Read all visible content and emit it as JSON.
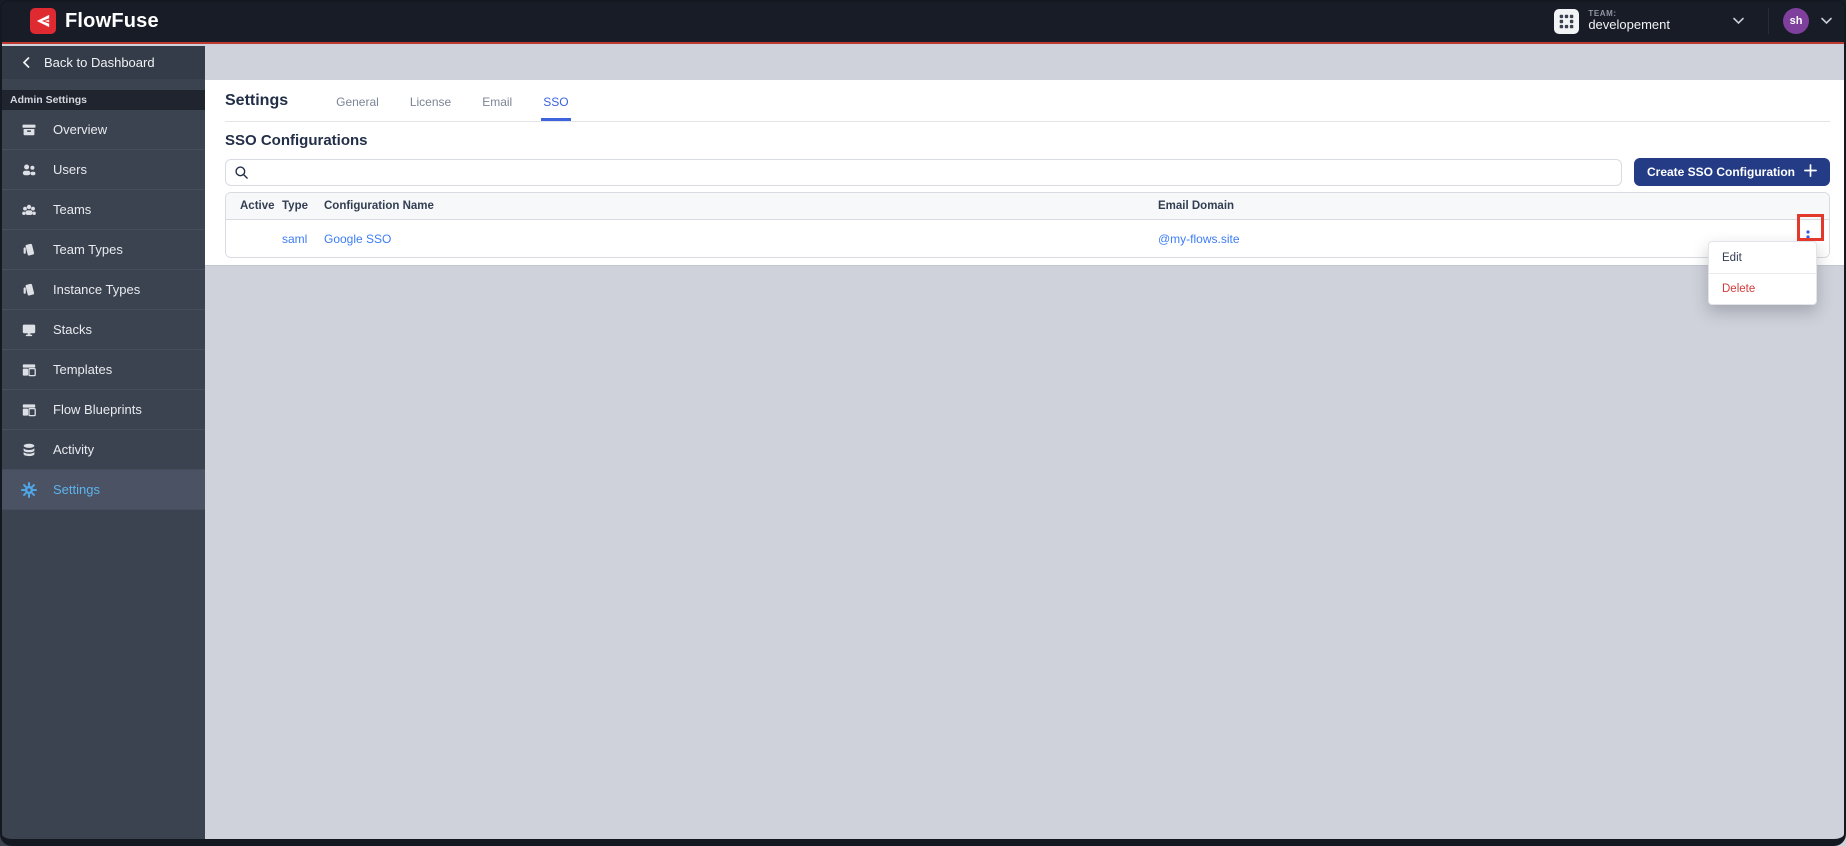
{
  "header": {
    "brand": "FlowFuse",
    "team_kicker": "TEAM:",
    "team_name": "developement",
    "avatar_initials": "sh"
  },
  "sidebar": {
    "back_label": "Back to Dashboard",
    "section_label": "Admin Settings",
    "items": [
      {
        "label": "Overview",
        "icon": "overview-icon",
        "selected": false
      },
      {
        "label": "Users",
        "icon": "users-icon",
        "selected": false
      },
      {
        "label": "Teams",
        "icon": "teams-icon",
        "selected": false
      },
      {
        "label": "Team Types",
        "icon": "team-types-icon",
        "selected": false
      },
      {
        "label": "Instance Types",
        "icon": "instance-types-icon",
        "selected": false
      },
      {
        "label": "Stacks",
        "icon": "stacks-icon",
        "selected": false
      },
      {
        "label": "Templates",
        "icon": "templates-icon",
        "selected": false
      },
      {
        "label": "Flow Blueprints",
        "icon": "flow-blueprints-icon",
        "selected": false
      },
      {
        "label": "Activity",
        "icon": "activity-icon",
        "selected": false
      },
      {
        "label": "Settings",
        "icon": "settings-icon",
        "selected": true
      }
    ]
  },
  "main": {
    "page_title": "Settings",
    "tabs": [
      {
        "label": "General",
        "active": false
      },
      {
        "label": "License",
        "active": false
      },
      {
        "label": "Email",
        "active": false
      },
      {
        "label": "SSO",
        "active": true
      }
    ],
    "section_title": "SSO Configurations",
    "search_placeholder": "",
    "search_value": "",
    "create_button_label": "Create SSO Configuration",
    "table": {
      "columns": [
        "Active",
        "Type",
        "Configuration Name",
        "Email Domain"
      ],
      "rows": [
        {
          "active": "",
          "type": "saml",
          "name": "Google SSO",
          "email_domain": "@my-flows.site"
        }
      ]
    },
    "context_menu": {
      "items": [
        {
          "label": "Edit",
          "danger": false
        },
        {
          "label": "Delete",
          "danger": true
        }
      ]
    }
  },
  "colors": {
    "header_bg": "#181C27",
    "accent_red_line": "#BE3A31",
    "brand_red": "#E02A32",
    "sidebar_bg": "#3B4250",
    "sidebar_selected_bg": "#4A5264",
    "sidebar_selected_text": "#5FB2EC",
    "tab_active_blue": "#3B63E0",
    "link_blue": "#3D7DF5",
    "button_navy": "#243C86",
    "danger_red": "#D23B3B",
    "annotation_red": "#E2392C",
    "avatar_purple": "#7E3F9D",
    "page_bg": "#CFD2DA"
  }
}
